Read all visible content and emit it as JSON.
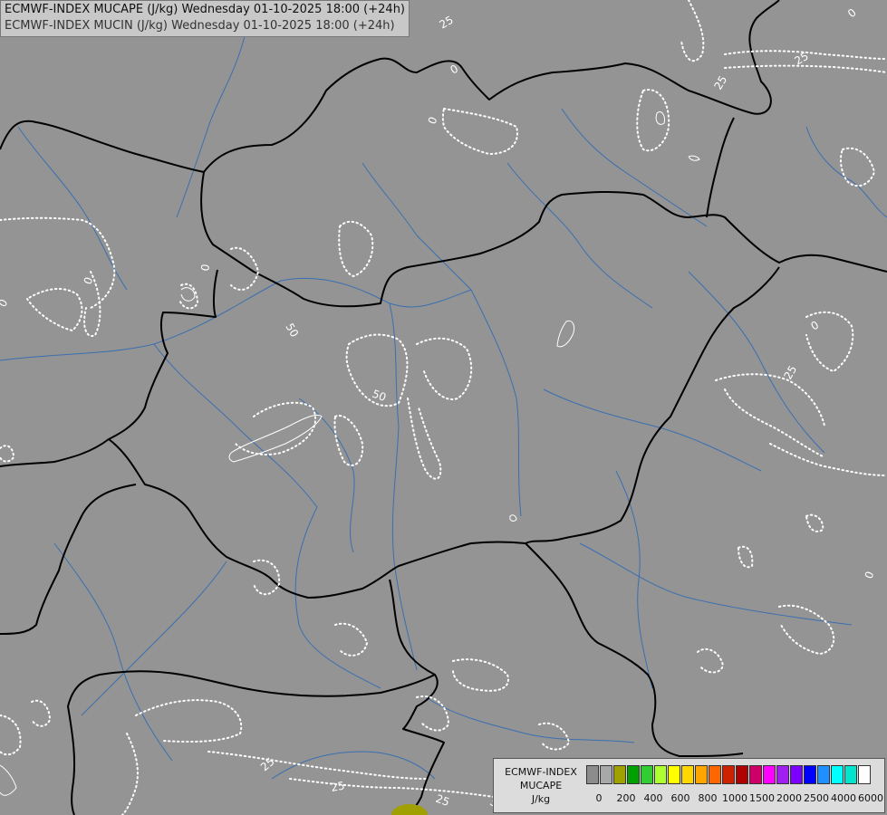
{
  "header": {
    "line1": "ECMWF-INDEX MUCAPE (J/kg) Wednesday 01-10-2025 18:00 (+24h)",
    "line2": "ECMWF-INDEX MUCIN (J/kg) Wednesday 01-10-2025 18:00 (+24h)"
  },
  "legend": {
    "title_line1": "ECMWF-INDEX",
    "title_line2": "MUCAPE",
    "title_line3": "J/kg",
    "swatch_colors": [
      "#8c8c8c",
      "#a8a8a8",
      "#a0a000",
      "#00a000",
      "#32cd32",
      "#adff2f",
      "#ffff00",
      "#ffd700",
      "#ffa500",
      "#ff6600",
      "#cc2200",
      "#b00000",
      "#cc0066",
      "#ff00ff",
      "#a020f0",
      "#7b00ff",
      "#0000ff",
      "#1e90ff",
      "#00ffff",
      "#00e5cc",
      "#ffffff"
    ],
    "tick_labels": [
      "0",
      "200",
      "400",
      "600",
      "800",
      "1000",
      "1500",
      "2000",
      "2500",
      "4000",
      "6000"
    ]
  },
  "contour_labels": [
    "25",
    "25",
    "25",
    "0",
    "0",
    "0",
    "0",
    "50",
    "50",
    "0",
    "25",
    "0",
    "25",
    "25",
    "50",
    "25",
    "0",
    "0"
  ],
  "colors": {
    "background": "#949494",
    "borders": "#000000",
    "rivers": "#3b6fb0",
    "cin_contours": "#ffffff",
    "cape_area": "#a0a000"
  }
}
